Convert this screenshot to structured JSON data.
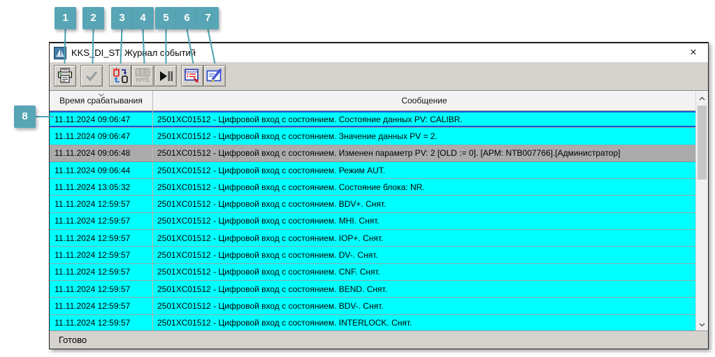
{
  "annotations": {
    "badges": [
      {
        "label": "1"
      },
      {
        "label": "2"
      },
      {
        "label": "3"
      },
      {
        "label": "4"
      },
      {
        "label": "5"
      },
      {
        "label": "6"
      },
      {
        "label": "7"
      },
      {
        "label": "8"
      }
    ]
  },
  "window": {
    "title": "KKS_DI_ST. Журнал событий",
    "close_label": "×"
  },
  "toolbar": {
    "buttons": [
      {
        "name": "print",
        "icon": "printer-icon"
      },
      {
        "name": "acknowledge",
        "icon": "check-icon",
        "disabled": true
      },
      {
        "name": "alarm-ack",
        "icon": "alarm-lamps-icon"
      },
      {
        "name": "units",
        "icon": "units-icon",
        "line1": "1.0",
        "line2": "m³/S",
        "disabled": true
      },
      {
        "name": "pause-resume",
        "icon": "play-pause-icon"
      },
      {
        "name": "event-filter",
        "icon": "event-list-icon"
      },
      {
        "name": "edit-comment",
        "icon": "note-pencil-icon"
      }
    ]
  },
  "table": {
    "columns": [
      "Время срабатывания",
      "Сообщение"
    ],
    "rows": [
      {
        "time": "11.11.2024 09:06:47",
        "message": "2501XC01512 - Цифровой вход с состоянием. Состояние данных PV: CALIBR.",
        "state": "selected"
      },
      {
        "time": "11.11.2024 09:06:47",
        "message": "2501XC01512 - Цифровой вход с состоянием. Значение данных PV = 2.",
        "state": "cyan"
      },
      {
        "time": "11.11.2024 09:06:48",
        "message": "2501XC01512 - Цифровой вход с состоянием. Изменен параметр  PV: 2 [OLD := 0]. [APM: NTB007766].[Администратор]",
        "state": "gray"
      },
      {
        "time": "11.11.2024 09:06:44",
        "message": "2501XC01512 - Цифровой вход с состоянием. Режим AUT.",
        "state": "cyan"
      },
      {
        "time": "11.11.2024 13:05:32",
        "message": "2501XC01512 - Цифровой вход с состоянием. Состояние блока: NR.",
        "state": "cyan"
      },
      {
        "time": "11.11.2024 12:59:57",
        "message": "2501XC01512 - Цифровой вход с состоянием. BDV+. Снят.",
        "state": "cyan"
      },
      {
        "time": "11.11.2024 12:59:57",
        "message": "2501XC01512 - Цифровой вход с состоянием. MHI. Снят.",
        "state": "cyan"
      },
      {
        "time": "11.11.2024 12:59:57",
        "message": "2501XC01512 - Цифровой вход с состоянием. IOP+. Снят.",
        "state": "cyan"
      },
      {
        "time": "11.11.2024 12:59:57",
        "message": "2501XC01512 - Цифровой вход с состоянием. DV-. Снят.",
        "state": "cyan"
      },
      {
        "time": "11.11.2024 12:59:57",
        "message": "2501XC01512 - Цифровой вход с состоянием. CNF. Снят.",
        "state": "cyan"
      },
      {
        "time": "11.11.2024 12:59:57",
        "message": "2501XC01512 - Цифровой вход с состоянием. BEND. Снят.",
        "state": "cyan"
      },
      {
        "time": "11.11.2024 12:59:57",
        "message": "2501XC01512 - Цифровой вход с состоянием. BDV-. Снят.",
        "state": "cyan"
      },
      {
        "time": "11.11.2024 12:59:57",
        "message": "2501XC01512 - Цифровой вход с состоянием. INTERLOCK. Снят.",
        "state": "cyan"
      }
    ]
  },
  "status_bar": {
    "text": "Готово"
  },
  "colors": {
    "event_row_cyan": "#00ffff",
    "event_row_gray": "#ababab",
    "selection_blue": "#1657d8",
    "annotation_teal": "#57a5b5"
  }
}
